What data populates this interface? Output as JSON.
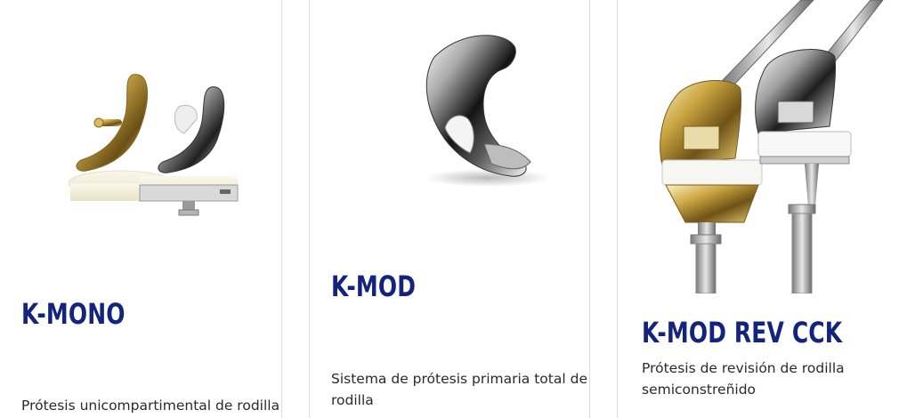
{
  "products": [
    {
      "title": "K-MONO",
      "description": "Prótesis unicompartimental de rodilla",
      "image_icon": "unicompartmental-knee-implant-icon"
    },
    {
      "title": "K-MOD",
      "description": "Sistema de prótesis primaria total de rodilla",
      "image_icon": "total-knee-femoral-component-icon"
    },
    {
      "title": "K-MOD REV CCK",
      "description": "Prótesis de revisión de rodilla semiconstreñido",
      "image_icon": "revision-knee-implant-icon"
    }
  ],
  "colors": {
    "title": "#14237e",
    "text": "#2a2a2a",
    "divider": "#dcdcdc"
  }
}
